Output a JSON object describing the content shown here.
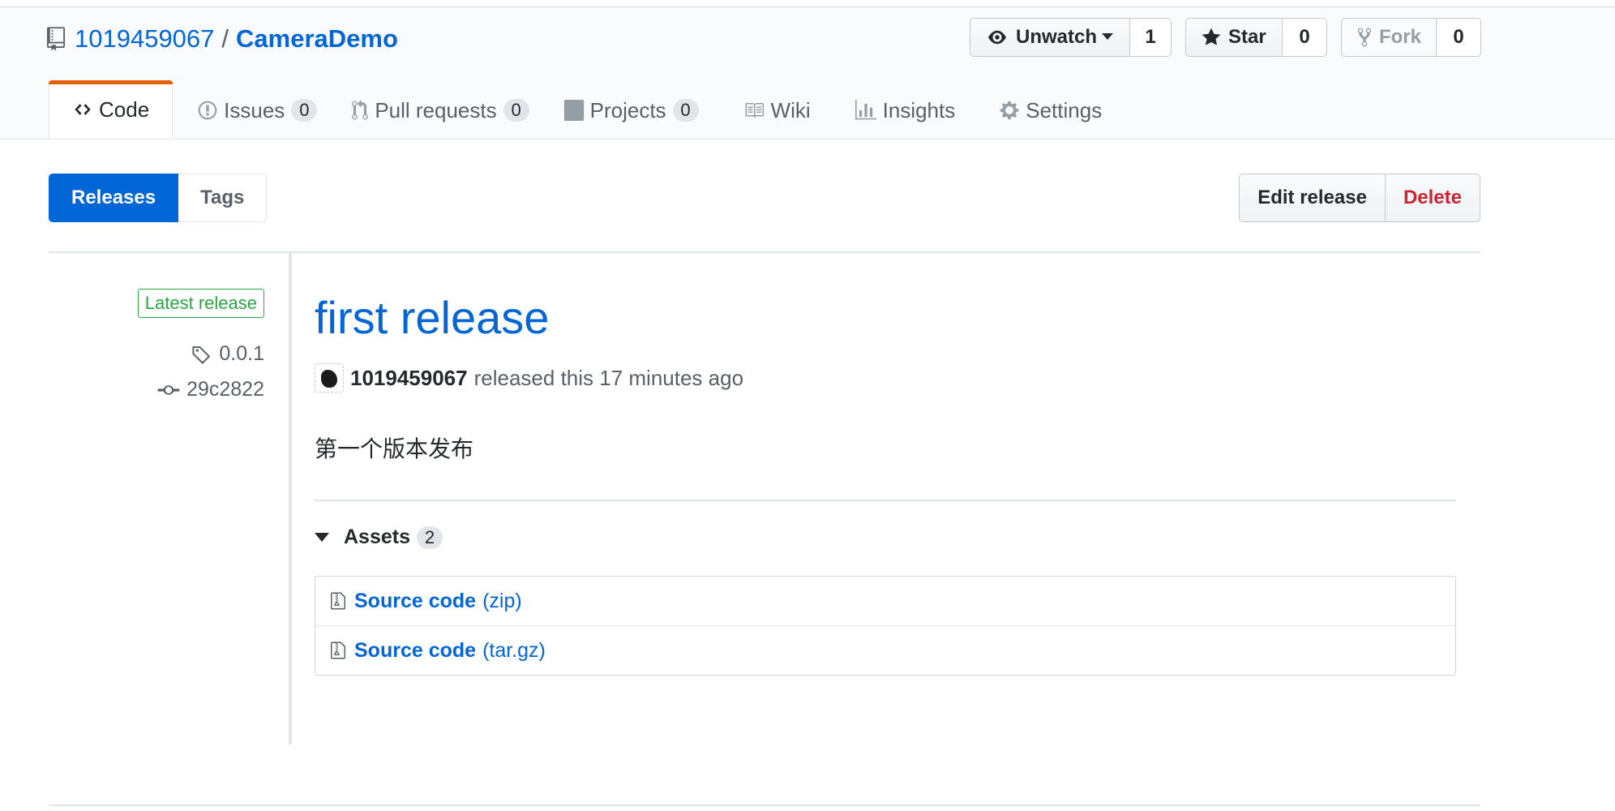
{
  "repo": {
    "owner": "1019459067",
    "separator": "/",
    "name": "CameraDemo"
  },
  "actions": {
    "watch": {
      "label": "Unwatch",
      "count": "1"
    },
    "star": {
      "label": "Star",
      "count": "0"
    },
    "fork": {
      "label": "Fork",
      "count": "0"
    }
  },
  "tabs": [
    {
      "label": "Code",
      "icon": "code-icon"
    },
    {
      "label": "Issues",
      "counter": "0",
      "icon": "issue-icon"
    },
    {
      "label": "Pull requests",
      "counter": "0",
      "icon": "pull-request-icon"
    },
    {
      "label": "Projects",
      "counter": "0",
      "icon": "project-icon"
    },
    {
      "label": "Wiki",
      "icon": "book-icon"
    },
    {
      "label": "Insights",
      "icon": "graph-icon"
    },
    {
      "label": "Settings",
      "icon": "gear-icon"
    }
  ],
  "subnav": {
    "releases": "Releases",
    "tags": "Tags"
  },
  "release_actions": {
    "edit": "Edit release",
    "delete": "Delete"
  },
  "release": {
    "label": "Latest release",
    "tag": "0.0.1",
    "commit": "29c2822",
    "title": "first release",
    "author": "1019459067",
    "released_text": "released this 17 minutes ago",
    "description": "第一个版本发布",
    "assets_label": "Assets",
    "assets_count": "2",
    "assets": [
      {
        "name": "Source code",
        "format": "(zip)"
      },
      {
        "name": "Source code",
        "format": "(tar.gz)"
      }
    ]
  },
  "colors": {
    "link": "#0366d6",
    "selected_tab_accent": "#e36209",
    "latest_label": "#28a745",
    "delete": "#cb2431"
  }
}
